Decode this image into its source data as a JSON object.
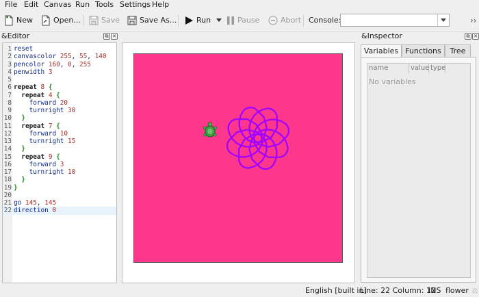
{
  "menubar": {
    "items": [
      "File",
      "Edit",
      "Canvas",
      "Run",
      "Tools",
      "Settings",
      "Help"
    ]
  },
  "toolbar": {
    "new_label": "New",
    "open_label": "Open...",
    "save_label": "Save",
    "save_as_label": "Save As...",
    "run_label": "Run",
    "pause_label": "Pause",
    "abort_label": "Abort",
    "console_label": "Console:",
    "console_value": "",
    "overflow": "››"
  },
  "editor": {
    "title": "&Editor",
    "lines": [
      {
        "n": "1",
        "tokens": [
          {
            "t": "reset",
            "c": "kw"
          }
        ]
      },
      {
        "n": "2",
        "tokens": [
          {
            "t": "canvascolor ",
            "c": "kw"
          },
          {
            "t": "255",
            "c": "num"
          },
          {
            "t": ", ",
            "c": "kw"
          },
          {
            "t": "55",
            "c": "num"
          },
          {
            "t": ", ",
            "c": "kw"
          },
          {
            "t": "140",
            "c": "num"
          }
        ]
      },
      {
        "n": "3",
        "tokens": [
          {
            "t": "pencolor ",
            "c": "kw"
          },
          {
            "t": "160",
            "c": "num"
          },
          {
            "t": ", ",
            "c": "kw"
          },
          {
            "t": "0",
            "c": "num"
          },
          {
            "t": ", ",
            "c": "kw"
          },
          {
            "t": "255",
            "c": "num"
          }
        ]
      },
      {
        "n": "4",
        "tokens": [
          {
            "t": "penwidth ",
            "c": "kw"
          },
          {
            "t": "3",
            "c": "num"
          }
        ]
      },
      {
        "n": "5",
        "tokens": []
      },
      {
        "n": "6",
        "tokens": [
          {
            "t": "repeat ",
            "c": "bold"
          },
          {
            "t": "8",
            "c": "num"
          },
          {
            "t": " ",
            "c": "kw"
          },
          {
            "t": "{",
            "c": "brace"
          }
        ]
      },
      {
        "n": "7",
        "tokens": [
          {
            "t": "  ",
            "c": "kw"
          },
          {
            "t": "repeat ",
            "c": "bold"
          },
          {
            "t": "4",
            "c": "num"
          },
          {
            "t": " ",
            "c": "kw"
          },
          {
            "t": "{",
            "c": "brace"
          }
        ]
      },
      {
        "n": "8",
        "tokens": [
          {
            "t": "    forward ",
            "c": "kw"
          },
          {
            "t": "20",
            "c": "num"
          }
        ]
      },
      {
        "n": "9",
        "tokens": [
          {
            "t": "    turnright ",
            "c": "kw"
          },
          {
            "t": "30",
            "c": "num"
          }
        ]
      },
      {
        "n": "10",
        "tokens": [
          {
            "t": "  ",
            "c": "kw"
          },
          {
            "t": "}",
            "c": "brace"
          }
        ]
      },
      {
        "n": "11",
        "tokens": [
          {
            "t": "  ",
            "c": "kw"
          },
          {
            "t": "repeat ",
            "c": "bold"
          },
          {
            "t": "7",
            "c": "num"
          },
          {
            "t": " ",
            "c": "kw"
          },
          {
            "t": "{",
            "c": "brace"
          }
        ]
      },
      {
        "n": "12",
        "tokens": [
          {
            "t": "    forward ",
            "c": "kw"
          },
          {
            "t": "10",
            "c": "num"
          }
        ]
      },
      {
        "n": "13",
        "tokens": [
          {
            "t": "    turnright ",
            "c": "kw"
          },
          {
            "t": "15",
            "c": "num"
          }
        ]
      },
      {
        "n": "14",
        "tokens": [
          {
            "t": "  ",
            "c": "kw"
          },
          {
            "t": "}",
            "c": "brace"
          }
        ]
      },
      {
        "n": "15",
        "tokens": [
          {
            "t": "  ",
            "c": "kw"
          },
          {
            "t": "repeat ",
            "c": "bold"
          },
          {
            "t": "9",
            "c": "num"
          },
          {
            "t": " ",
            "c": "kw"
          },
          {
            "t": "{",
            "c": "brace"
          }
        ]
      },
      {
        "n": "16",
        "tokens": [
          {
            "t": "    forward ",
            "c": "kw"
          },
          {
            "t": "3",
            "c": "num"
          }
        ]
      },
      {
        "n": "17",
        "tokens": [
          {
            "t": "    turnright ",
            "c": "kw"
          },
          {
            "t": "10",
            "c": "num"
          }
        ]
      },
      {
        "n": "18",
        "tokens": [
          {
            "t": "  ",
            "c": "kw"
          },
          {
            "t": "}",
            "c": "brace"
          }
        ]
      },
      {
        "n": "19",
        "tokens": [
          {
            "t": "}",
            "c": "brace"
          }
        ]
      },
      {
        "n": "20",
        "tokens": []
      },
      {
        "n": "21",
        "tokens": [
          {
            "t": "go ",
            "c": "kw"
          },
          {
            "t": "145",
            "c": "num"
          },
          {
            "t": ", ",
            "c": "kw"
          },
          {
            "t": "145",
            "c": "num"
          }
        ]
      },
      {
        "n": "22",
        "tokens": [
          {
            "t": "direction ",
            "c": "kw"
          },
          {
            "t": "0",
            "c": "num"
          }
        ],
        "current": true
      }
    ]
  },
  "canvas": {
    "background_color": "#ff378c",
    "pen_color": "#a000ff",
    "turtle_icon": "turtle-icon"
  },
  "inspector": {
    "title": "&Inspector",
    "tabs": [
      "Variables",
      "Functions",
      "Tree"
    ],
    "active_tab": 0,
    "columns": [
      "name",
      "value",
      "type"
    ],
    "empty_text": "No variables"
  },
  "statusbar": {
    "language": "English [built in]",
    "position": "Line: 22 Column: 12",
    "mode": "INS",
    "file": "flower"
  }
}
